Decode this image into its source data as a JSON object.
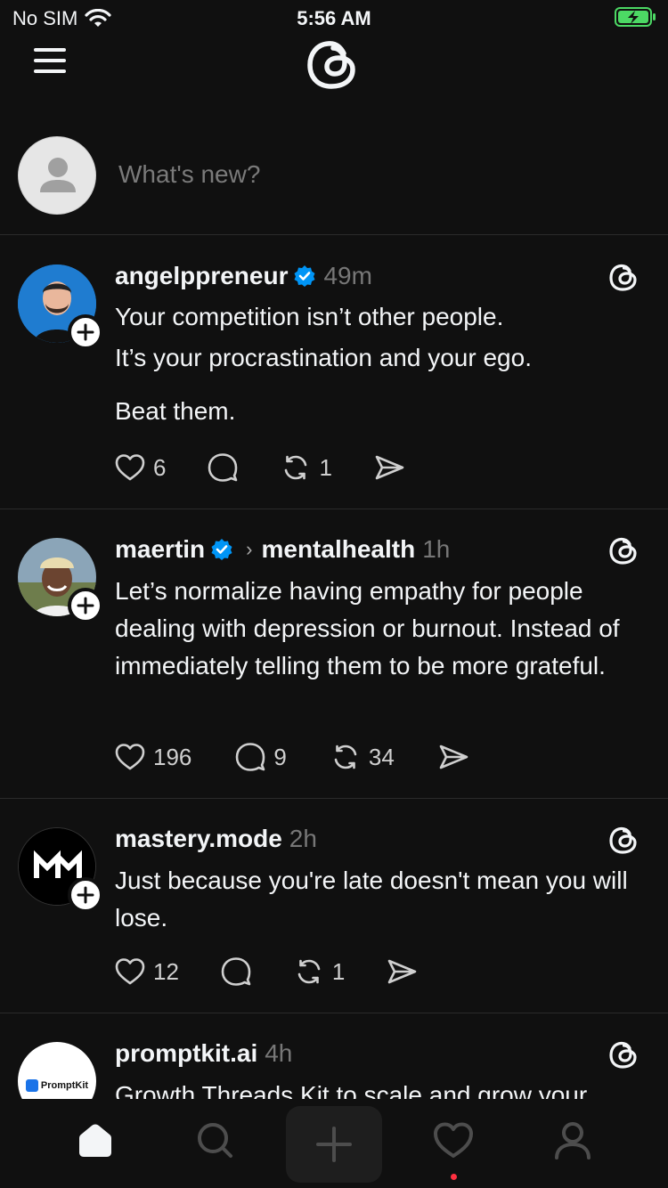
{
  "status_bar": {
    "carrier": "No SIM",
    "time": "5:56 AM"
  },
  "composer": {
    "placeholder": "What's new?"
  },
  "posts": [
    {
      "username": "angelppreneur",
      "verified": true,
      "time": "49m",
      "text_lines": [
        "Your competition isn’t other people.",
        "It’s your procrastination and your ego."
      ],
      "text_extra": "Beat them.",
      "likes": "6",
      "comments": "",
      "reposts": "1"
    },
    {
      "username": "maertin",
      "verified": true,
      "community": "mentalhealth",
      "time": "1h",
      "text": "Let’s normalize having empathy for people dealing with depression or burnout. Instead of immediately telling them to be more grateful.",
      "likes": "196",
      "comments": "9",
      "reposts": "34"
    },
    {
      "username": "mastery.mode",
      "verified": false,
      "time": "2h",
      "text": "Just because you're late doesn't mean you will lose.",
      "likes": "12",
      "comments": "",
      "reposts": "1"
    },
    {
      "username": "promptkit.ai",
      "verified": false,
      "time": "4h",
      "text": "Growth Threads Kit to scale and grow your",
      "avatar_logo_text": "PromptKit"
    }
  ],
  "colors": {
    "background": "#101010",
    "text": "#f3f5f7",
    "muted": "#777777",
    "verified": "#0095f6",
    "notification_dot": "#ff3040"
  },
  "nav": [
    "home-icon",
    "search-icon",
    "compose-icon",
    "heart-icon",
    "profile-icon"
  ]
}
